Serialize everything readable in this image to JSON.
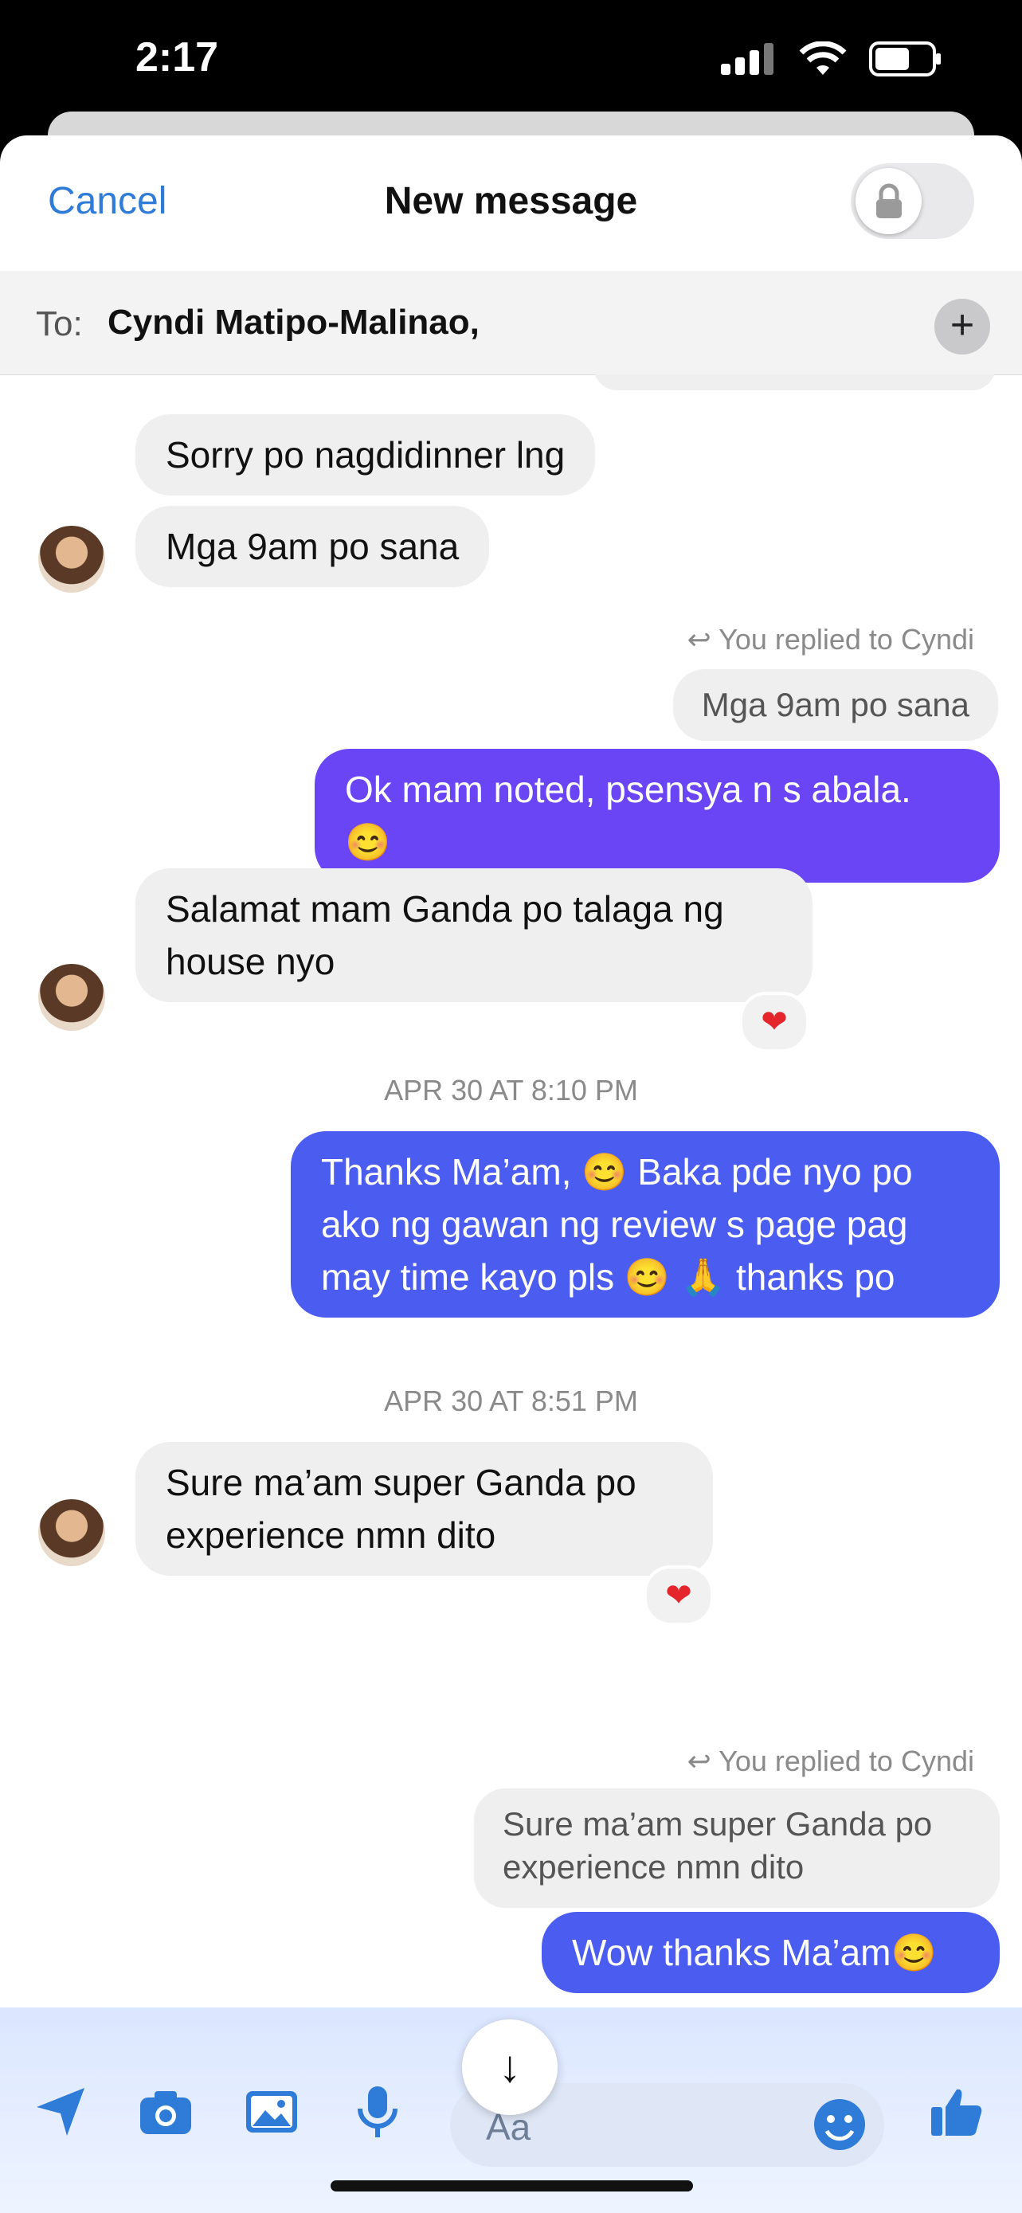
{
  "status_bar": {
    "time": "2:17"
  },
  "header": {
    "cancel_label": "Cancel",
    "title": "New message"
  },
  "to_bar": {
    "label": "To:",
    "recipient": "Cyndi Matipo-Malinao,"
  },
  "messages": {
    "m1": "Sorry po nagdidinner lng",
    "m2": "Mga 9am po sana",
    "reply1_label": "You replied to Cyndi",
    "reply1_quote": "Mga 9am po sana",
    "m3_line1": "Ok mam noted, psensya n s abala.",
    "m3_emoji": "😊",
    "m4_line1": "Salamat mam Ganda po talaga ng",
    "m4_line2": "house nyo",
    "reaction": "❤",
    "ts1": "APR 30 AT 8:10 PM",
    "m5_line1": "Thanks Ma’am, 😊 Baka pde nyo po",
    "m5_line2": "ako ng gawan ng review s page pag",
    "m5_line3": "may time kayo pls 😊 🙏 thanks po",
    "ts2": "APR 30 AT 8:51 PM",
    "m6_line1": "Sure ma’am super Ganda po",
    "m6_line2": "experience nmn dito",
    "reply2_label": "You replied to Cyndi",
    "reply2_quote_line1": "Sure ma’am super Ganda po",
    "reply2_quote_line2": "experience nmn dito",
    "m7": "Wow thanks Ma’am😊"
  },
  "composer": {
    "placeholder": "Aa"
  },
  "colors": {
    "accent": "#2f7bd8",
    "outgoing_purple": "#6a45f5",
    "outgoing_blue": "#4b5cf0",
    "incoming": "#efefef"
  },
  "icons": [
    "signal-icon",
    "wifi-icon",
    "battery-icon",
    "lock-icon",
    "plus-icon",
    "reply-arrow-icon",
    "heart-icon",
    "arrow-down-icon",
    "location-icon",
    "camera-icon",
    "gallery-icon",
    "mic-icon",
    "emoji-icon",
    "thumbs-up-icon"
  ]
}
